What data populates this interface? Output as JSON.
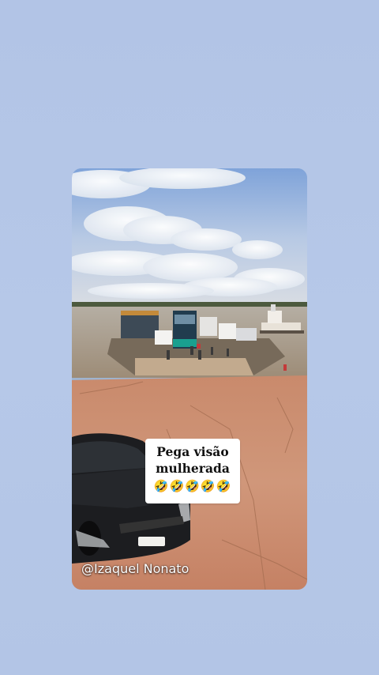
{
  "caption": {
    "line1": "Pega visão",
    "line2": "mulherada",
    "emojis": "🤣🤣🤣🤣🤣"
  },
  "watermark": {
    "handle": "@Izaquel Nonato"
  },
  "colors": {
    "background": "#b4c6e7",
    "sky": "#8fb0dd",
    "water": "#a79a86",
    "ground": "#c9876a",
    "car": "#1c1d20"
  }
}
